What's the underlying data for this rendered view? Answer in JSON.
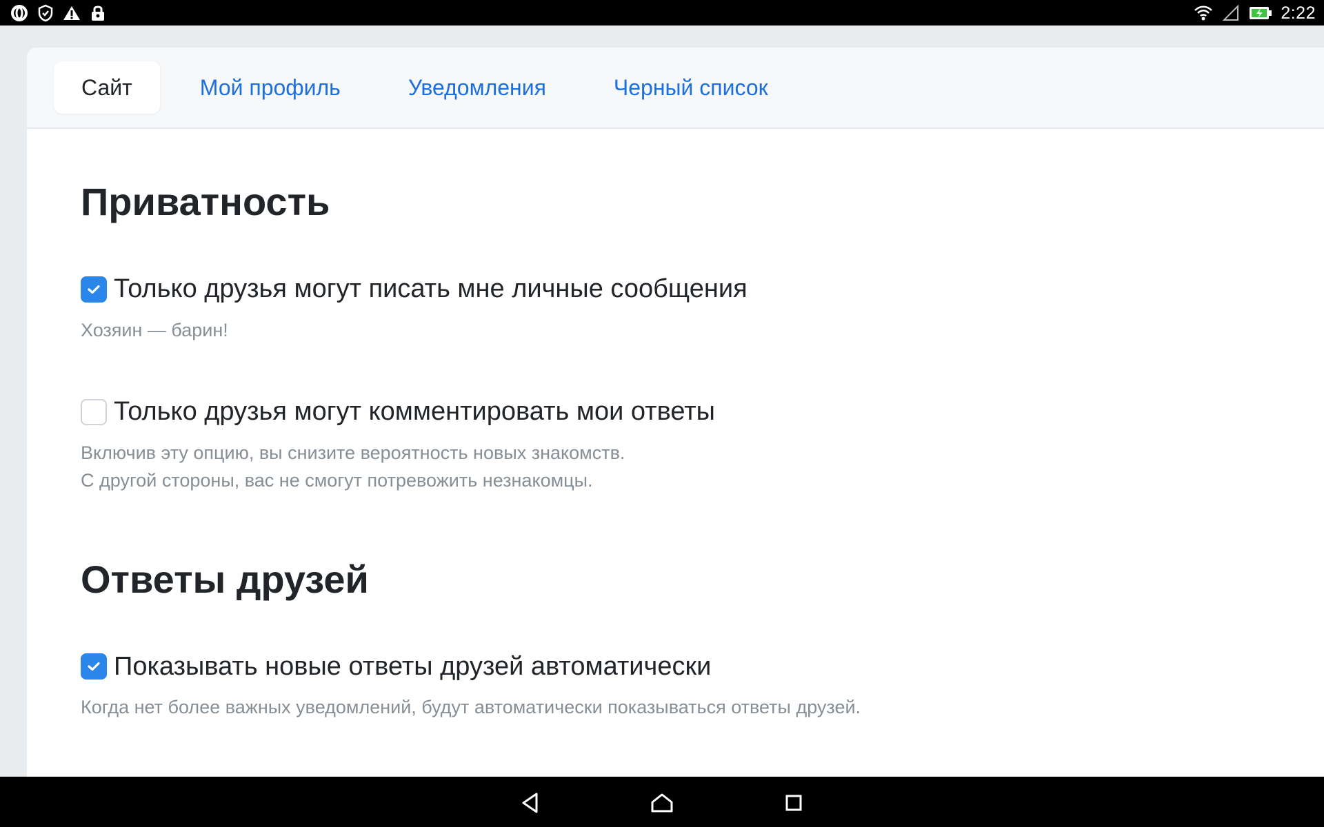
{
  "status_bar": {
    "time": "2:22",
    "icons_left": [
      "opera-icon",
      "shield-check-icon",
      "warning-icon",
      "lock-icon"
    ],
    "icons_right": [
      "wifi-icon",
      "signal-icon",
      "battery-charging-icon"
    ]
  },
  "tabs": [
    {
      "label": "Сайт",
      "active": true
    },
    {
      "label": "Мой профиль",
      "active": false
    },
    {
      "label": "Уведомления",
      "active": false
    },
    {
      "label": "Черный список",
      "active": false
    }
  ],
  "privacy": {
    "title": "Приватность",
    "options": [
      {
        "label": "Только друзья могут писать мне личные сообщения",
        "checked": true,
        "hint_lines": [
          "Хозяин — барин!"
        ]
      },
      {
        "label": "Только друзья могут комментировать мои ответы",
        "checked": false,
        "hint_lines": [
          "Включив эту опцию, вы снизите вероятность новых знакомств.",
          "С другой стороны, вас не смогут потревожить незнакомцы."
        ]
      }
    ]
  },
  "friends_answers": {
    "title": "Ответы друзей",
    "options": [
      {
        "label": "Показывать новые ответы друзей автоматически",
        "checked": true,
        "hint_lines": [
          "Когда нет более важных уведомлений, будут автоматически показываться ответы друзей."
        ]
      }
    ]
  },
  "colors": {
    "accent": "#2a86e8",
    "link": "#1e6fd9",
    "text": "#212529",
    "muted": "#868e96"
  }
}
